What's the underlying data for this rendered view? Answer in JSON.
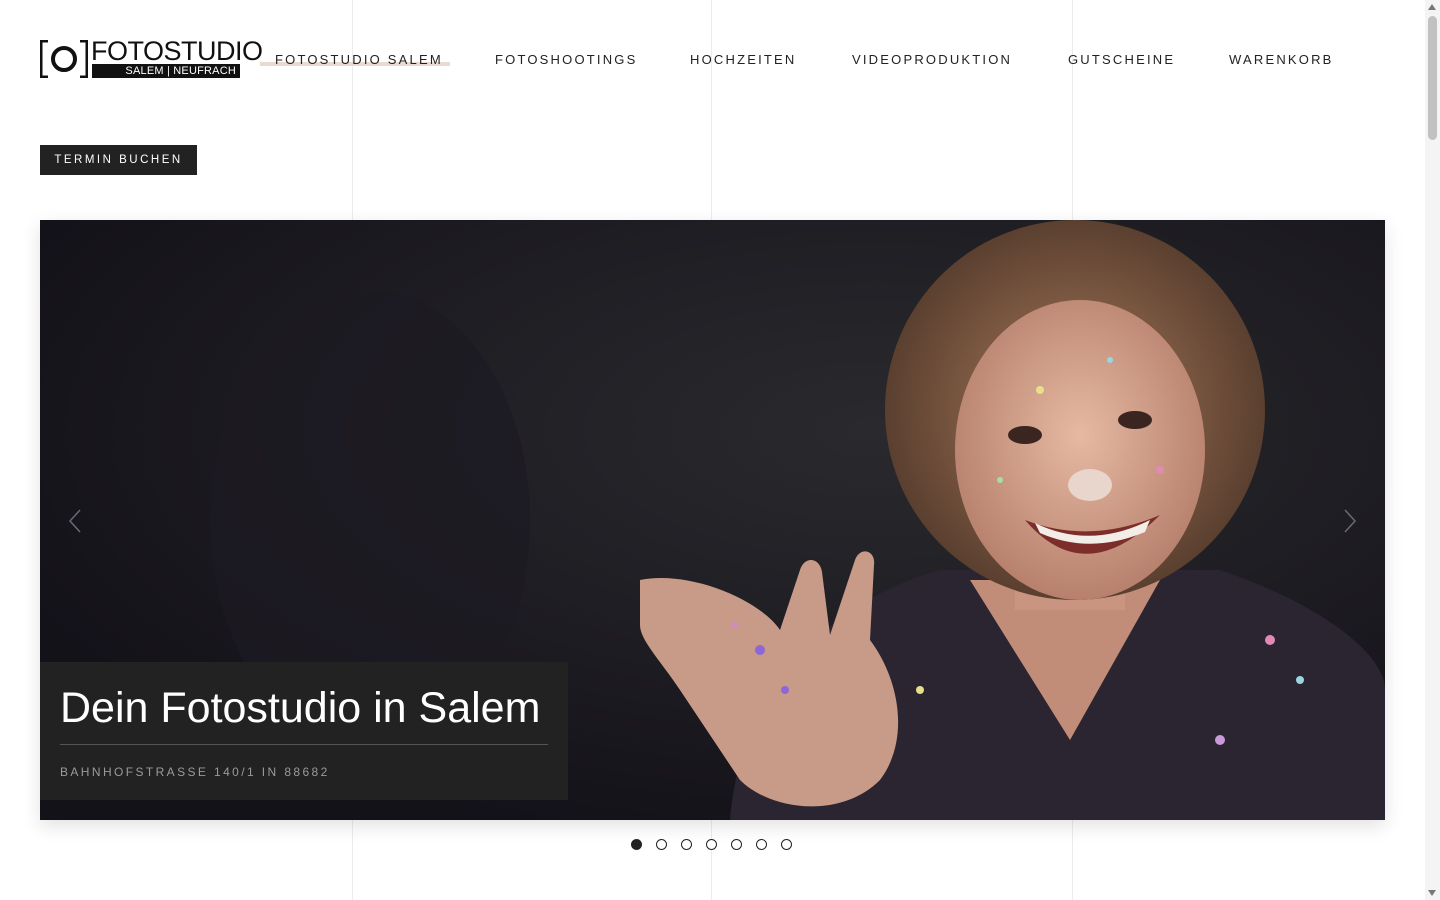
{
  "header": {
    "logo": {
      "line1_bold": "FOTO",
      "line1_rest": "STUDIO",
      "line2": "SALEM | NEUFRACH"
    },
    "nav": [
      {
        "label": "FOTOSTUDIO SALEM",
        "active": true
      },
      {
        "label": "FOTOSHOOTINGS",
        "active": false
      },
      {
        "label": "HOCHZEITEN",
        "active": false
      },
      {
        "label": "VIDEOPRODUKTION",
        "active": false
      },
      {
        "label": "GUTSCHEINE",
        "active": false
      },
      {
        "label": "WARENKORB",
        "active": false
      }
    ],
    "cta_label": "TERMIN BUCHEN"
  },
  "hero": {
    "title": "Dein Fotostudio in Salem",
    "subtitle": "BAHNHOFSTRASSE 140/1 IN 88682",
    "slide_count": 7,
    "active_slide": 1
  },
  "colors": {
    "dark": "#222222",
    "nav_underline": "#ead9d2",
    "hero_bg": "#16141c"
  }
}
